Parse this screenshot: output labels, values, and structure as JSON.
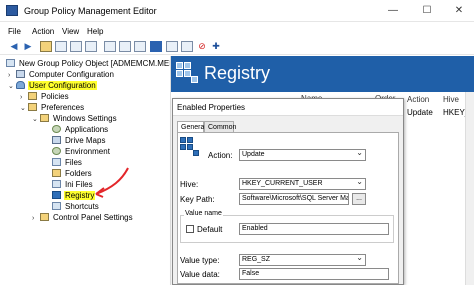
{
  "window": {
    "title": "Group Policy Management Editor",
    "minimize_glyph": "—",
    "maximize_glyph": "☐",
    "close_glyph": "✕"
  },
  "menu": [
    "File",
    "Action",
    "View",
    "Help"
  ],
  "toolbar": {
    "icons": [
      "back-icon",
      "forward-icon",
      "up-folder-icon",
      "show-hide-tree-icon",
      "refresh-icon",
      "export-list-icon",
      "properties-icon",
      "help-icon",
      "view-icon",
      "list-icon",
      "delete-icon",
      "add-icon"
    ],
    "add_glyph": "✚",
    "delete_glyph": "⊘"
  },
  "tree": {
    "root": "New Group Policy Object [ADMEMCM.MEMCM",
    "computer_configuration": "Computer Configuration",
    "user_configuration": "User Configuration",
    "policies": "Policies",
    "preferences": "Preferences",
    "windows_settings": "Windows Settings",
    "children": [
      "Applications",
      "Drive Maps",
      "Environment",
      "Files",
      "Folders",
      "Ini Files",
      "Registry",
      "Shortcuts"
    ],
    "control_panel_settings": "Control Panel Settings",
    "expand_glyph": "›",
    "collapse_glyph": "⌄"
  },
  "right_panel": {
    "title": "Registry",
    "columns": [
      "Name",
      "Order",
      "Action",
      "Hive"
    ],
    "row": {
      "action": "Update",
      "hive": "HKEY_"
    }
  },
  "dialog": {
    "title": "Enabled Properties",
    "tabs": [
      "General",
      "Common"
    ],
    "action_label": "Action:",
    "action_value": "Update",
    "hive_label": "Hive:",
    "hive_value": "HKEY_CURRENT_USER",
    "key_path_label": "Key Path:",
    "key_path_value": "Software\\Microsoft\\SQL Server Management S",
    "browse_label": "...",
    "value_name_group": "Value name",
    "default_label": "Default",
    "value_name_value": "Enabled",
    "value_type_label": "Value type:",
    "value_type_value": "REG_SZ",
    "value_data_label": "Value data:",
    "value_data_value": "False"
  },
  "colors": {
    "header_blue": "#1f5fa8",
    "highlight_yellow": "#ffff2e",
    "annotation_red": "#e3262a"
  }
}
